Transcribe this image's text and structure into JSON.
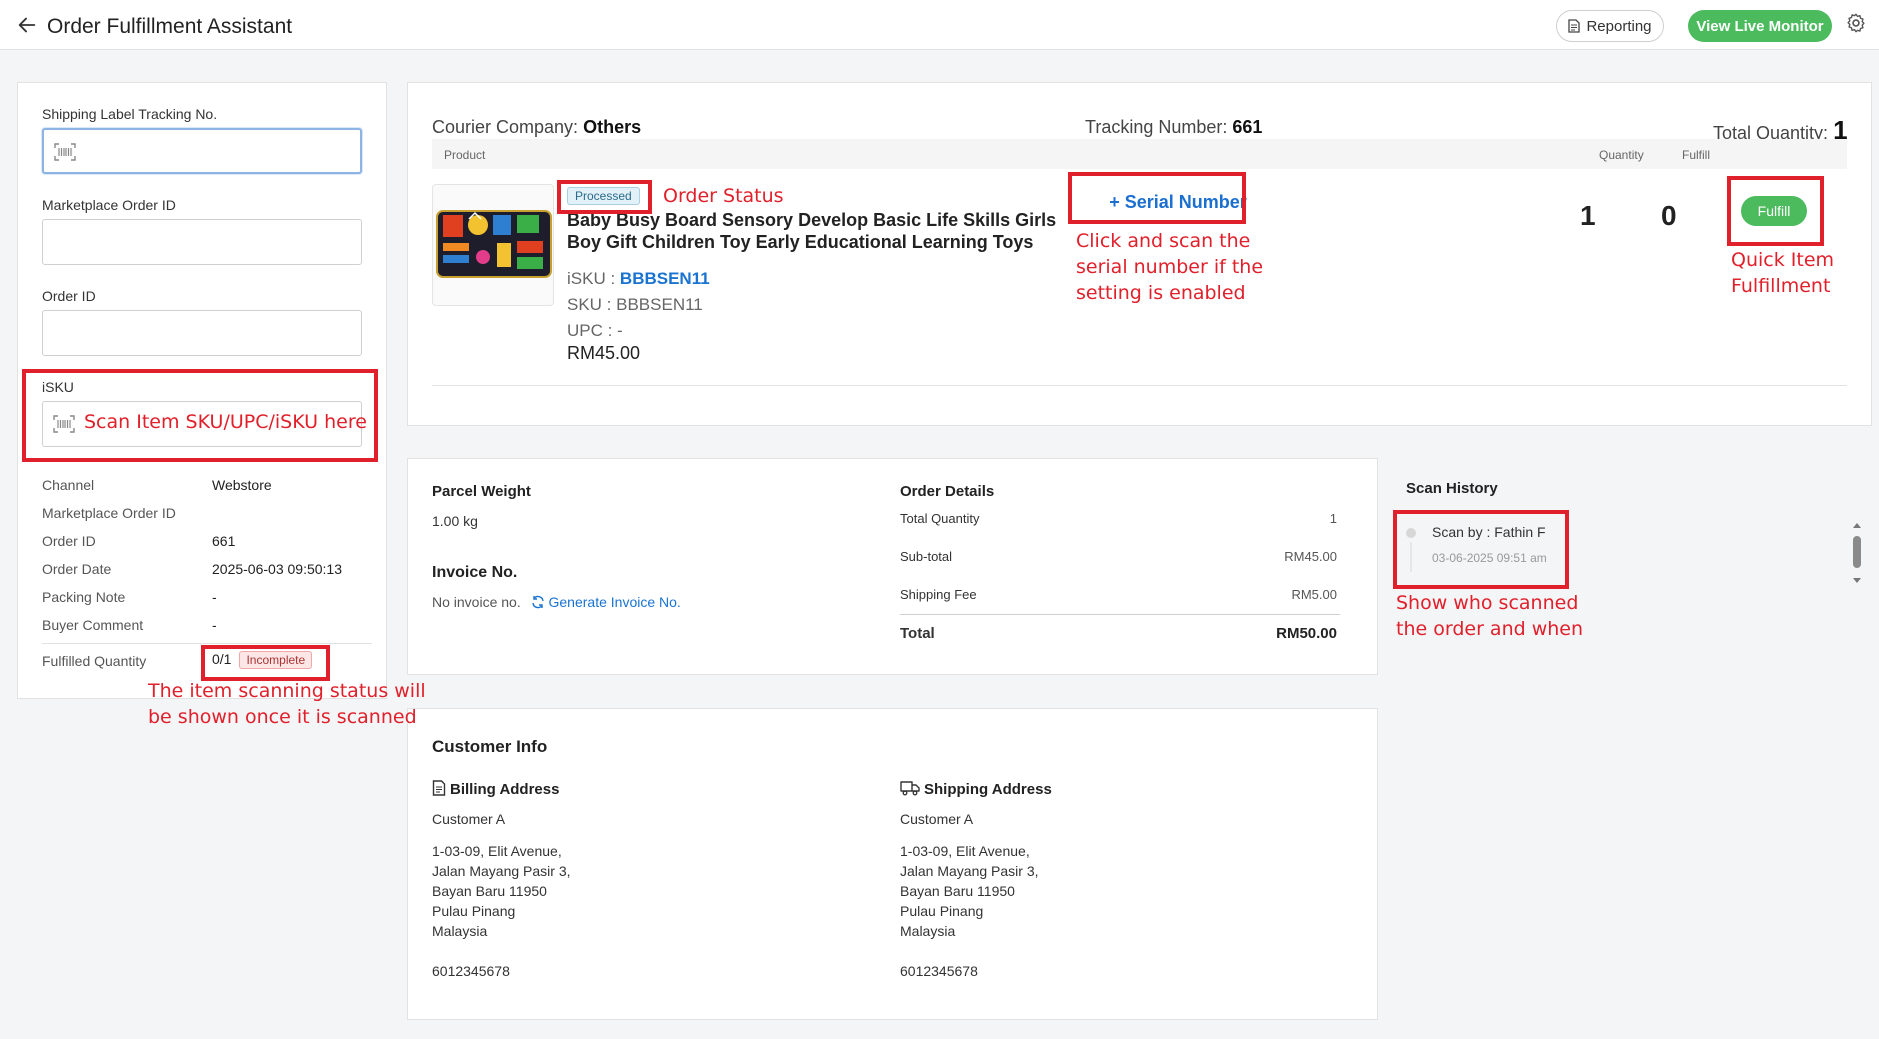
{
  "header": {
    "title": "Order Fulfillment Assistant",
    "reporting_label": "Reporting",
    "live_monitor_label": "View Live Monitor"
  },
  "form": {
    "shipping_label": "Shipping Label Tracking No.",
    "marketplace_label": "Marketplace Order ID",
    "order_id_label": "Order ID",
    "isku_label": "iSKU",
    "isku_annotation": "Scan Item SKU/UPC/iSKU here"
  },
  "order_info": {
    "rows": [
      {
        "label": "Channel",
        "value": "Webstore"
      },
      {
        "label": "Marketplace Order ID",
        "value": ""
      },
      {
        "label": "Order ID",
        "value": "661"
      },
      {
        "label": "Order Date",
        "value": "2025-06-03 09:50:13"
      },
      {
        "label": "Packing Note",
        "value": "-"
      },
      {
        "label": "Buyer Comment",
        "value": "-"
      }
    ],
    "fulfilled_label": "Fulfilled Quantity",
    "fulfilled_value": "0/1",
    "fulfilled_status": "Incomplete",
    "fulfilled_annotation_line1": "The item scanning status will",
    "fulfilled_annotation_line2": "be shown once it is scanned"
  },
  "main": {
    "courier_label": "Courier Company:",
    "courier_value": "Others",
    "tracking_label": "Tracking Number:",
    "tracking_value": "661",
    "total_qty_label": "Total Quantity:",
    "total_qty_value": "1",
    "col_product": "Product",
    "col_quantity": "Quantity",
    "col_fulfill": "Fulfill"
  },
  "product": {
    "status": "Processed",
    "status_annotation": "Order Status",
    "name": "Baby Busy Board Sensory Develop Basic Life Skills Girls Boy Gift Children Toy Early Educational Learning Toys",
    "isku_label": "iSKU :",
    "isku_value": "BBBSEN11",
    "sku_line": "SKU : BBBSEN11",
    "upc_line": "UPC : -",
    "price": "RM45.00",
    "serial_button": "+ Serial Number",
    "serial_annotation_1": "Click and scan the",
    "serial_annotation_2": "serial number if the",
    "serial_annotation_3": "setting is enabled",
    "quantity": "1",
    "fulfilled": "0",
    "fulfill_button": "Fulfill",
    "fulfill_annotation_1": "Quick Item",
    "fulfill_annotation_2": "Fulfillment"
  },
  "parcel": {
    "weight_title": "Parcel Weight",
    "weight_value": "1.00 kg",
    "invoice_title": "Invoice No.",
    "invoice_none": "No invoice no.",
    "generate_link": "Generate Invoice No."
  },
  "order_details": {
    "title": "Order Details",
    "total_qty_label": "Total Quantity",
    "total_qty_value": "1",
    "subtotal_label": "Sub-total",
    "subtotal_value": "RM45.00",
    "shipping_label": "Shipping Fee",
    "shipping_value": "RM5.00",
    "total_label": "Total",
    "total_value": "RM50.00"
  },
  "scan_history": {
    "title": "Scan History",
    "scan_by": "Scan by : Fathin F",
    "scan_time": "03-06-2025 09:51 am",
    "annotation_1": "Show who scanned",
    "annotation_2": "the order and when"
  },
  "customer": {
    "title": "Customer Info",
    "billing_title": "Billing Address",
    "shipping_title": "Shipping Address",
    "billing_name": "Customer A",
    "billing_line1": "1-03-09, Elit Avenue,",
    "billing_line2": "Jalan Mayang Pasir 3,",
    "billing_line3": "Bayan Baru 11950",
    "billing_line4": "Pulau Pinang",
    "billing_line5": "Malaysia",
    "billing_phone": "6012345678",
    "shipping_name": "Customer A",
    "shipping_line1": "1-03-09, Elit Avenue,",
    "shipping_line2": "Jalan Mayang Pasir 3,",
    "shipping_line3": "Bayan Baru 11950",
    "shipping_line4": "Pulau Pinang",
    "shipping_line5": "Malaysia",
    "shipping_phone": "6012345678"
  },
  "colors": {
    "accent_green": "#4cbb5e",
    "link_blue": "#1a73d0",
    "annotation_red": "#e0202a"
  }
}
